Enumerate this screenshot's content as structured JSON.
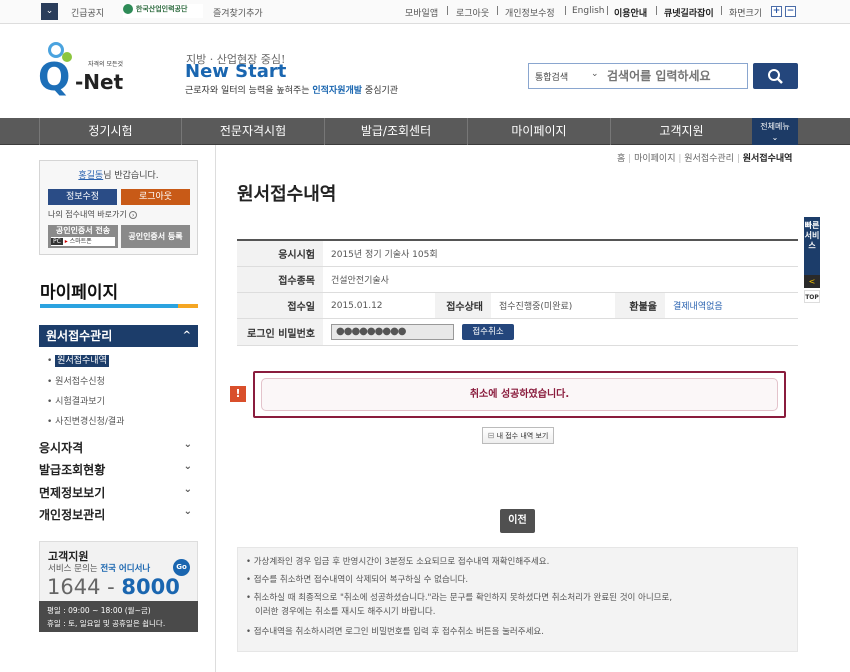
{
  "utilbar": {
    "notice": "긴급공지",
    "org": "한국산업인력공단",
    "bookmark": "즐겨찾기추가",
    "links": [
      "모바일앱",
      "로그아웃",
      "개인정보수정",
      "English"
    ],
    "bold_links": [
      "이용안내",
      "큐넷길라잡이"
    ],
    "fontsize_label": "화면크기",
    "plus": "+",
    "minus": "−"
  },
  "header": {
    "logo_tag": "자격의 모든것",
    "logo_q": "Q",
    "logo_net": "-Net",
    "slogan_small": "지방 · 산업현장 중심!",
    "slogan_big": "New Start",
    "slogan_sub_pre": "근로자와 일터의 능력을 높혀주는 ",
    "slogan_sub_hl": "인적자원개발",
    "slogan_sub_post": " 중심기관"
  },
  "search": {
    "category": "통합검색",
    "placeholder": "검색어를 입력하세요",
    "button_icon": "search-icon"
  },
  "nav": {
    "items": [
      "정기시험",
      "전문자격시험",
      "발급/조회센터",
      "마이페이지",
      "고객지원"
    ],
    "all_menu": "전체메뉴",
    "all_menu_chev": "⌄"
  },
  "sidebar": {
    "greeting_name": "홍길동",
    "greeting_suffix": "님 반갑습니다.",
    "edit_info": "정보수정",
    "logout": "로그아웃",
    "shortcut": "나의 접수내역 바로가기",
    "cert_transfer": "공인인증서 전송",
    "cert_pc": "PC",
    "cert_phone": "스마트폰",
    "cert_register": "공인인증서 등록",
    "mypage_title": "마이페이지",
    "menu_main": "원서접수관리",
    "menu_main_chev": "^",
    "submenu": [
      "원서접수내역",
      "원서접수신청",
      "시험결과보기",
      "사진변경신청/결과"
    ],
    "menus": [
      "응시자격",
      "발급조회현황",
      "면제정보보기",
      "개인정보관리"
    ],
    "menu_chev": "⌄",
    "cs_title": "고객지원",
    "cs_sub_pre": "서비스 문의는 ",
    "cs_sub_hl": "전국 어디서나",
    "cs_go": "Go",
    "cs_phone_a": "1644 - ",
    "cs_phone_b": "8000",
    "cs_hours1": "평일 : 09:00 ~ 18:00 (월~금)",
    "cs_hours2": "휴일 : 토, 일요일 및 공휴일은 쉽니다."
  },
  "content": {
    "breadcrumb": [
      "홈",
      "마이페이지",
      "원서접수관리"
    ],
    "breadcrumb_current": "원서접수내역",
    "page_title": "원서접수내역",
    "table": {
      "exam_label": "응시시험",
      "exam_value": "2015년 정기 기술사 105회",
      "category_label": "접수종목",
      "category_value": "건설안전기술사",
      "date_label": "접수일",
      "date_value": "2015.01.12",
      "status_label": "접수상태",
      "status_value": "접수진행중(미완료)",
      "refund_label": "환불율",
      "refund_value": "결제내역없음",
      "password_label": "로그인 비밀번호",
      "password_value": "●●●●●●●●●",
      "cancel_button": "접수취소"
    },
    "alert_icon": "!",
    "alert_message": "취소에 성공하였습니다.",
    "view_button": "내 접수 내역 보기",
    "view_button_icon": "⊟",
    "prev_button": "이전",
    "notes": [
      "가상계좌인 경우 입금 후 반영시간이 3분정도 소요되므로 접수내역 재확인해주세요.",
      "접수를 취소하면 접수내역이 삭제되어 복구하실 수 없습니다.",
      "취소하실 때 최종적으로 \"취소에 성공하셨습니다.\"라는 문구를 확인하지 못하셨다면 취소처리가 완료된 것이 아니므로,",
      "이러한 경우에는 취소를 재시도 해주시기 바랍니다.",
      "접수내역을 취소하시려면 로그인 비밀번호를 입력 후 접수취소 버튼을 눌러주세요."
    ]
  },
  "quick": {
    "label": "빠른서비스",
    "arrow": "<",
    "top": "TOP"
  }
}
